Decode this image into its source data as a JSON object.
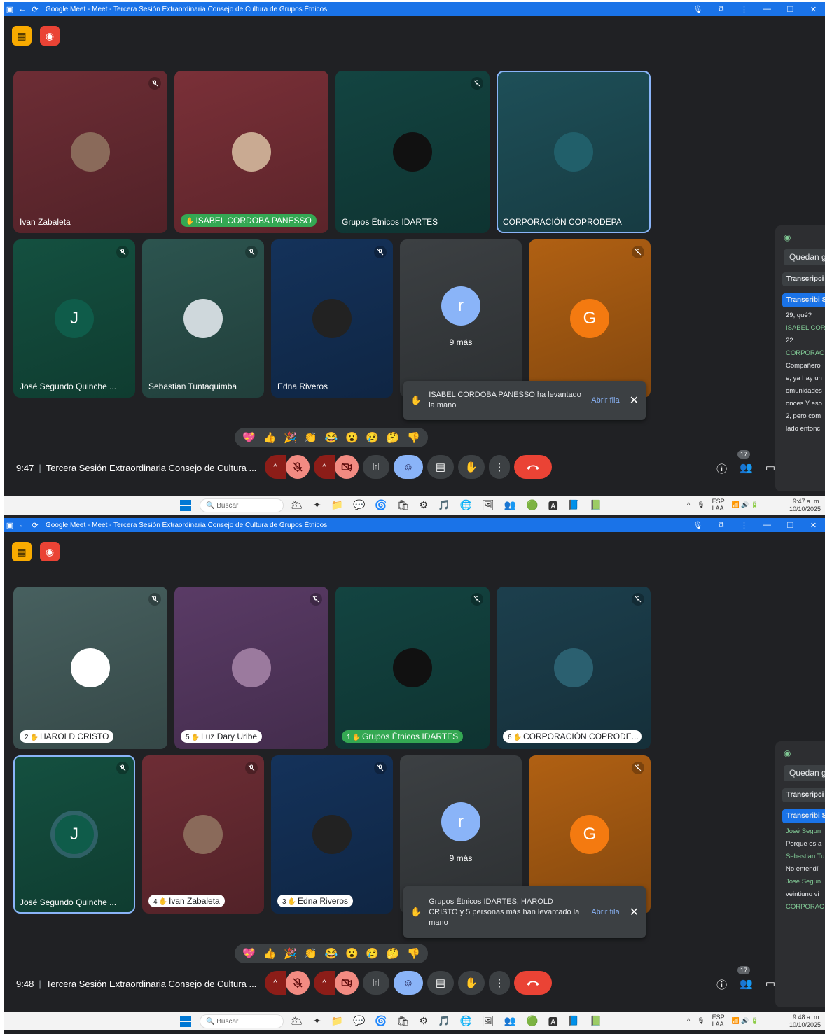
{
  "screens": [
    {
      "window_title": "Google Meet - Meet - Tercera Sesión Extraordinaria Consejo de Cultura de Grupos Étnicos",
      "tiles": [
        {
          "name": "Ivan Zabaleta",
          "hand": ""
        },
        {
          "name": "ISABEL CORDOBA PANESSO",
          "hand": ""
        },
        {
          "name": "Grupos Étnicos IDARTES",
          "hand": ""
        },
        {
          "name": "CORPORACIÓN COPRODEPA",
          "hand": ""
        },
        {
          "name": "José Segundo Quinche ...",
          "hand": "",
          "initial": "J"
        },
        {
          "name": "Sebastian Tuntaquimba",
          "hand": ""
        },
        {
          "name": "Edna Riveros",
          "hand": ""
        },
        {
          "name": "9 más",
          "hand": "",
          "initial": "r"
        },
        {
          "name": "",
          "hand": "",
          "initial": "G"
        }
      ],
      "notification": {
        "text": "ISABEL CORDOBA PANESSO ha levantado la mano",
        "action": "Abrir fila"
      },
      "time": "9:47",
      "meeting_title": "Tercera Sesión Extraordinaria Consejo de Cultura ...",
      "participants_count": "17",
      "side": {
        "quedan": "Quedan gratuita",
        "transcripcion": "Transcripci en vivo",
        "transcribiendo": "Transcribi Spanish (M",
        "lines": [
          {
            "text": "29, qué?",
            "green": false
          },
          {
            "text": "ISABEL COR",
            "green": true
          },
          {
            "text": "22",
            "green": false
          },
          {
            "text": "CORPORAC",
            "green": true
          },
          {
            "text": "Compañero",
            "green": false
          },
          {
            "text": "e, ya hay un",
            "green": false
          },
          {
            "text": "omunidades",
            "green": false
          },
          {
            "text": "onces Y eso",
            "green": false
          },
          {
            "text": "2, pero com",
            "green": false
          },
          {
            "text": "lado entonc",
            "green": false
          }
        ]
      },
      "clock_time": "9:47 a. m.",
      "clock_date": "10/10/2025"
    },
    {
      "window_title": "Google Meet - Meet - Tercera Sesión Extraordinaria Consejo de Cultura de Grupos Étnicos",
      "tiles": [
        {
          "name": "HAROLD CRISTO",
          "hand": "2"
        },
        {
          "name": "Luz Dary Uribe",
          "hand": "5"
        },
        {
          "name": "Grupos Étnicos IDARTES",
          "hand": "1"
        },
        {
          "name": "CORPORACIÓN COPRODE...",
          "hand": "6"
        },
        {
          "name": "José Segundo Quinche ...",
          "hand": "",
          "initial": "J"
        },
        {
          "name": "Ivan Zabaleta",
          "hand": "4"
        },
        {
          "name": "Edna Riveros",
          "hand": "3"
        },
        {
          "name": "9 más",
          "hand": "",
          "initial": "r"
        },
        {
          "name": "",
          "hand": "",
          "initial": "G"
        }
      ],
      "notification": {
        "text": "Grupos Étnicos IDARTES, HAROLD CRISTO y 5 personas más han levantado la mano",
        "action": "Abrir fila"
      },
      "time": "9:48",
      "meeting_title": "Tercera Sesión Extraordinaria Consejo de Cultura ...",
      "participants_count": "17",
      "side": {
        "quedan": "Quedan gratuita",
        "transcripcion": "Transcripci en vivo",
        "transcribiendo": "Transcribi Spanish (M",
        "lines": [
          {
            "text": "José Segun",
            "green": true
          },
          {
            "text": "Porque es a",
            "green": false
          },
          {
            "text": "Sebastian Tu",
            "green": true
          },
          {
            "text": "No entendí",
            "green": false
          },
          {
            "text": "José Segun",
            "green": true
          },
          {
            "text": "veintiuno vi",
            "green": false
          },
          {
            "text": "CORPORAC",
            "green": true
          }
        ]
      },
      "clock_time": "9:48 a. m.",
      "clock_date": "10/10/2025"
    }
  ],
  "taskbar": {
    "search_placeholder": "Buscar",
    "lang_1": "ESP",
    "lang_2": "LAA"
  },
  "emoji_reactions": [
    "💖",
    "👍",
    "🎉",
    "👏",
    "😂",
    "😮",
    "😢",
    "🤔",
    "👎"
  ],
  "icons": {
    "mic_off": "mic-off-icon",
    "cam_off": "camera-off-icon",
    "hand": "hand-icon",
    "end_call": "end-call-icon"
  }
}
